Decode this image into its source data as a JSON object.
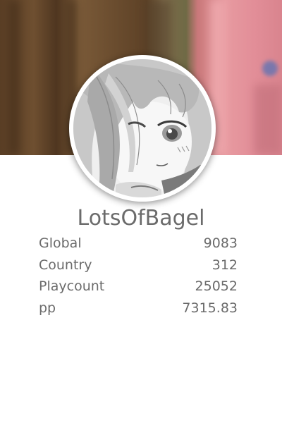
{
  "profile": {
    "username": "LotsOfBagel"
  },
  "stats": [
    {
      "label": "Global",
      "value": "9083"
    },
    {
      "label": "Country",
      "value": "312"
    },
    {
      "label": "Playcount",
      "value": "25052"
    },
    {
      "label": "pp",
      "value": "7315.83"
    }
  ],
  "colors": {
    "text": "#6b6b6b",
    "card_background": "#ffffff",
    "avatar_border": "#ffffff"
  },
  "icons": {
    "banner": "blurred-background-image",
    "avatar": "anime-girl-portrait"
  }
}
